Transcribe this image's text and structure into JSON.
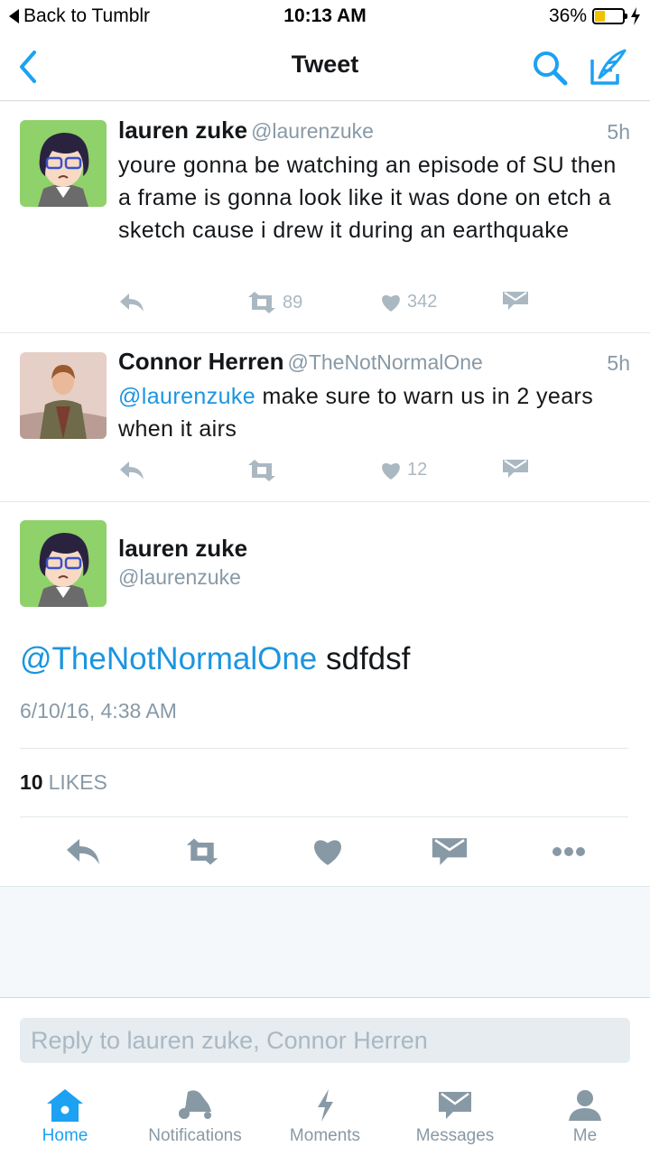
{
  "status_bar": {
    "back_label": "Back to Tumblr",
    "time": "10:13 AM",
    "battery": "36%",
    "battery_level": 0.36
  },
  "nav": {
    "title": "Tweet",
    "icons": [
      "chevron-left-icon",
      "search-icon",
      "compose-icon"
    ]
  },
  "tweets": [
    {
      "name": "lauren zuke",
      "handle": "@laurenzuke",
      "ago": "5h",
      "text": "youre gonna be watching an episode of SU then a frame is gonna look like it was done on etch a sketch cause i drew it during an earthquake",
      "retweets": "89",
      "likes": "342"
    },
    {
      "name": "Connor Herren",
      "handle": "@TheNotNormalOne",
      "ago": "5h",
      "mention": "@laurenzuke",
      "text": " make sure to warn us in 2 years when it airs",
      "retweets": "",
      "likes": "12"
    }
  ],
  "focused": {
    "name": "lauren zuke",
    "handle": "@laurenzuke",
    "mention": "@TheNotNormalOne",
    "text": " sdfdsf",
    "date": "6/10/16, 4:38 AM",
    "likes_count": "10",
    "likes_label": "LIKES"
  },
  "reply": {
    "placeholder": "Reply to lauren zuke, Connor Herren"
  },
  "tabs": [
    {
      "label": "Home",
      "icon": "home-icon",
      "active": true
    },
    {
      "label": "Notifications",
      "icon": "bell-icon",
      "active": false
    },
    {
      "label": "Moments",
      "icon": "lightning-icon",
      "active": false
    },
    {
      "label": "Messages",
      "icon": "envelope-icon",
      "active": false
    },
    {
      "label": "Me",
      "icon": "person-icon",
      "active": false
    }
  ],
  "colors": {
    "accent": "#1da1f2",
    "mention": "#1b95e0",
    "muted": "#8899a6",
    "icon": "#aab8c2"
  }
}
